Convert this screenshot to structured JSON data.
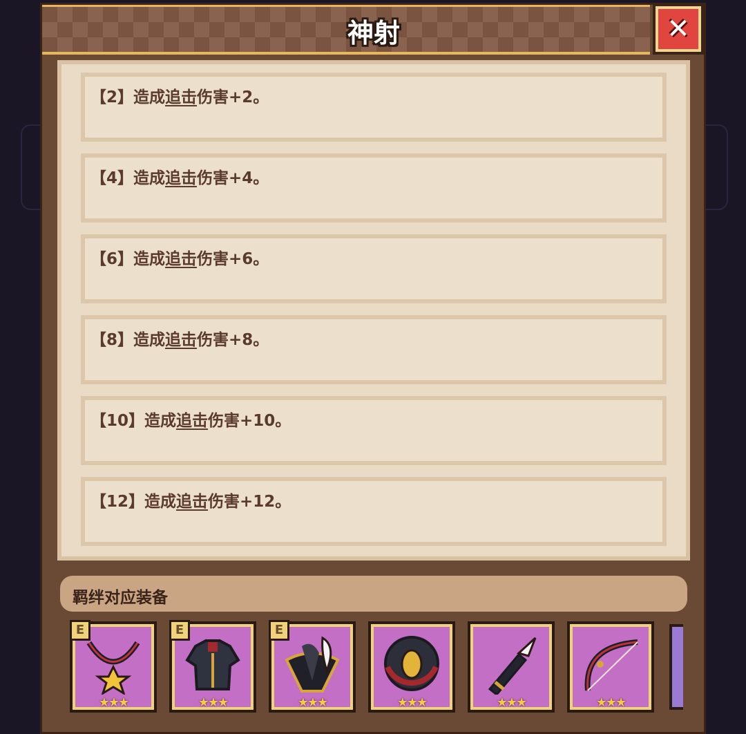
{
  "title": "神射",
  "close": "close",
  "effects": [
    {
      "level": "【2】",
      "pre": "造成",
      "keyword": "追击",
      "post": "伤害+2。"
    },
    {
      "level": "【4】",
      "pre": "造成",
      "keyword": "追击",
      "post": "伤害+4。"
    },
    {
      "level": "【6】",
      "pre": "造成",
      "keyword": "追击",
      "post": "伤害+6。"
    },
    {
      "level": "【8】",
      "pre": "造成",
      "keyword": "追击",
      "post": "伤害+8。"
    },
    {
      "level": "【10】",
      "pre": "造成",
      "keyword": "追击",
      "post": "伤害+10。"
    },
    {
      "level": "【12】",
      "pre": "造成",
      "keyword": "追击",
      "post": "伤害+12。"
    }
  ],
  "bond": {
    "label": "羁绊对应装备",
    "items": [
      {
        "icon": "necklace-icon",
        "badge": "E",
        "stars": "★★★"
      },
      {
        "icon": "armor-icon",
        "badge": "E",
        "stars": "★★★"
      },
      {
        "icon": "hat-icon",
        "badge": "E",
        "stars": "★★★"
      },
      {
        "icon": "shield-icon",
        "badge": "",
        "stars": "★★★"
      },
      {
        "icon": "quiver-icon",
        "badge": "",
        "stars": "★★★"
      },
      {
        "icon": "bow-icon",
        "badge": "",
        "stars": "★★★"
      }
    ]
  },
  "colors": {
    "slot": "#c46fc6",
    "accent": "#f0d27a",
    "close": "#e0463f"
  }
}
